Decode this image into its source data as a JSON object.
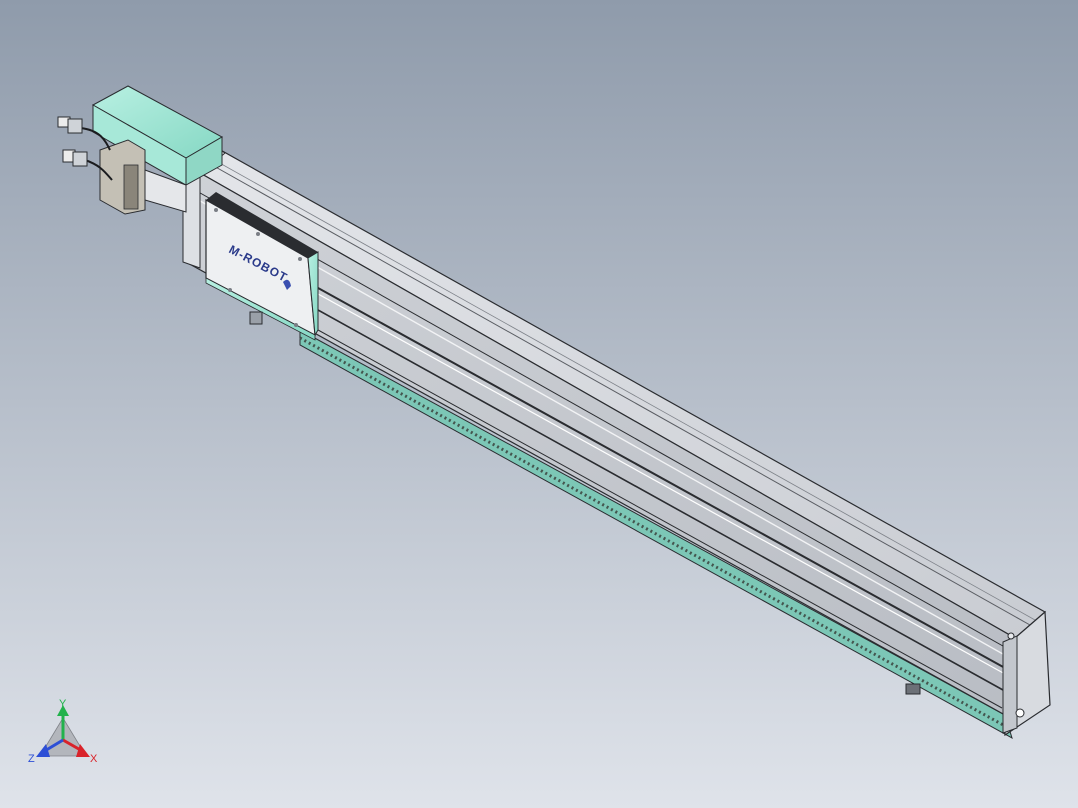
{
  "model": {
    "logo_text": "M-ROBOT"
  },
  "triad": {
    "x_label": "X",
    "y_label": "Y",
    "z_label": "Z"
  },
  "colors": {
    "background_top": "#8f9bab",
    "background_bottom": "#dfe3ea",
    "rail_face": "#c9ccd2",
    "rail_edge": "#2a2c30",
    "accent_teal": "#9fe5d4",
    "x_axis": "#d9232a",
    "y_axis": "#22b24c",
    "z_axis": "#2d4fd6"
  }
}
